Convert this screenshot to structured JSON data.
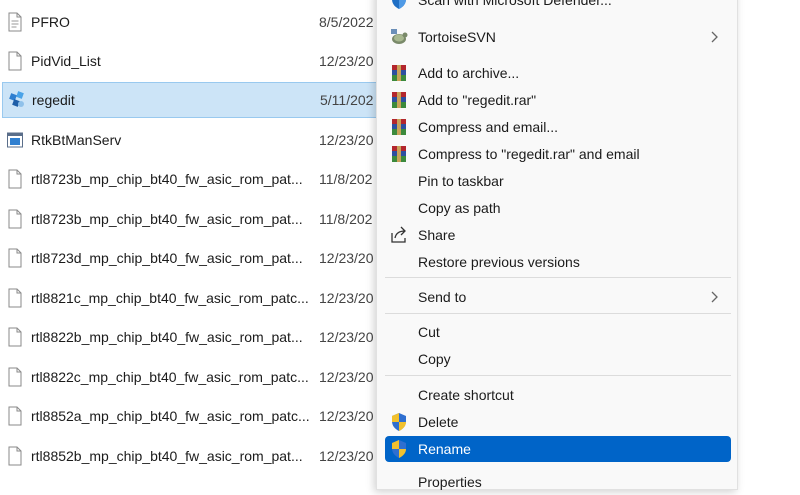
{
  "files": [
    {
      "name": "PFRO",
      "date": "8/5/2022",
      "icon": "text-file-icon"
    },
    {
      "name": "PidVid_List",
      "date": "12/23/20",
      "icon": "blank-file-icon"
    },
    {
      "name": "regedit",
      "date": "5/11/202",
      "icon": "regedit-icon",
      "selected": true
    },
    {
      "name": "RtkBtManServ",
      "date": "12/23/20",
      "icon": "application-icon"
    },
    {
      "name": "rtl8723b_mp_chip_bt40_fw_asic_rom_pat...",
      "date": "11/8/202",
      "icon": "blank-file-icon"
    },
    {
      "name": "rtl8723b_mp_chip_bt40_fw_asic_rom_pat...",
      "date": "11/8/202",
      "icon": "blank-file-icon"
    },
    {
      "name": "rtl8723d_mp_chip_bt40_fw_asic_rom_pat...",
      "date": "12/23/20",
      "icon": "blank-file-icon"
    },
    {
      "name": "rtl8821c_mp_chip_bt40_fw_asic_rom_patc...",
      "date": "12/23/20",
      "icon": "blank-file-icon"
    },
    {
      "name": "rtl8822b_mp_chip_bt40_fw_asic_rom_pat...",
      "date": "12/23/20",
      "icon": "blank-file-icon"
    },
    {
      "name": "rtl8822c_mp_chip_bt40_fw_asic_rom_patc...",
      "date": "12/23/20",
      "icon": "blank-file-icon"
    },
    {
      "name": "rtl8852a_mp_chip_bt40_fw_asic_rom_patc...",
      "date": "12/23/20",
      "icon": "blank-file-icon"
    },
    {
      "name": "rtl8852b_mp_chip_bt40_fw_asic_rom_pat...",
      "date": "12/23/20",
      "icon": "blank-file-icon"
    }
  ],
  "menu": {
    "items": {
      "defender": "Scan with Microsoft Defender...",
      "tortoise": "TortoiseSVN",
      "add_archive": "Add to archive...",
      "add_rar": "Add to \"regedit.rar\"",
      "compress_email": "Compress and email...",
      "compress_rar_email": "Compress to \"regedit.rar\" and email",
      "pin_taskbar": "Pin to taskbar",
      "copy_path": "Copy as path",
      "share": "Share",
      "restore": "Restore previous versions",
      "send_to": "Send to",
      "cut": "Cut",
      "copy": "Copy",
      "create_shortcut": "Create shortcut",
      "delete": "Delete",
      "rename": "Rename",
      "properties": "Properties"
    },
    "highlighted": "rename"
  },
  "colors": {
    "selection_bg": "#cce4f7",
    "menu_highlight": "#0064c8",
    "winrar_red": "#b3262d",
    "winrar_blue": "#2d4fa0"
  }
}
